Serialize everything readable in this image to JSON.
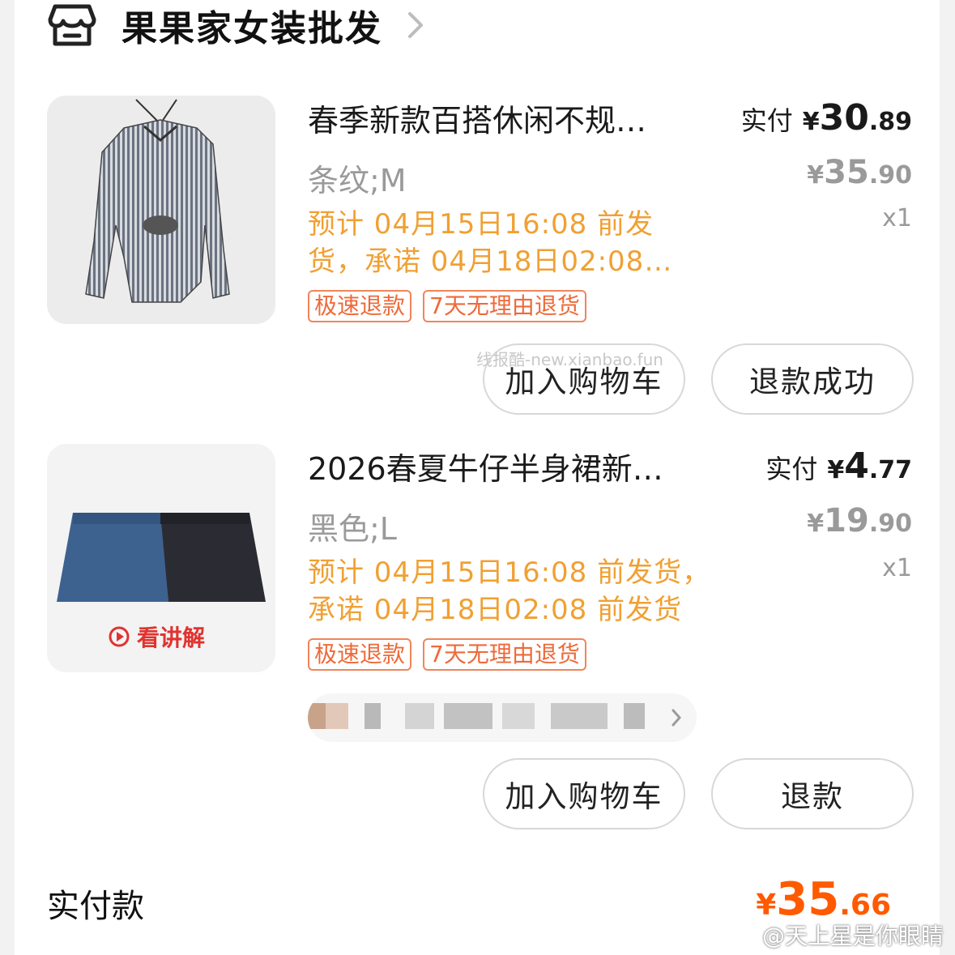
{
  "shop": {
    "name": "果果家女装批发",
    "icon": "store-icon",
    "arrow": "chevron-right-icon"
  },
  "items": [
    {
      "title": "春季新款百搭休闲不规…",
      "variant": "条纹;M",
      "paid_label": "实付",
      "currency": "¥",
      "paid_int": "30",
      "paid_dec": ".89",
      "orig_int": "35",
      "orig_dec": ".90",
      "qty": "x1",
      "ship_line1": "预计 04月15日16:08 前发",
      "ship_line2": "货，承诺 04月18日02:08…",
      "tags": [
        "极速退款",
        "7天无理由退货"
      ],
      "buttons": [
        "加入购物车",
        "退款成功"
      ]
    },
    {
      "title": "2026春夏牛仔半身裙新…",
      "variant": "黑色;L",
      "paid_label": "实付",
      "currency": "¥",
      "paid_int": "4",
      "paid_dec": ".77",
      "orig_int": "19",
      "orig_dec": ".90",
      "qty": "x1",
      "ship_line1": "预计 04月15日16:08 前发货，",
      "ship_line2": "承诺 04月18日02:08 前发货",
      "tags": [
        "极速退款",
        "7天无理由退货"
      ],
      "video_label": "看讲解",
      "buttons": [
        "加入购物车",
        "退款"
      ]
    }
  ],
  "watermark": "线报酷-new.xianbao.fun",
  "total": {
    "label": "实付款",
    "currency": "¥",
    "int": "35",
    "dec": ".66"
  },
  "weibo_watermark": "@天上星是你眼睛",
  "colors": {
    "accent": "#ff5a00",
    "ship": "#f0a033",
    "tag": "#ee6a3a",
    "muted": "#9a9a9a"
  }
}
